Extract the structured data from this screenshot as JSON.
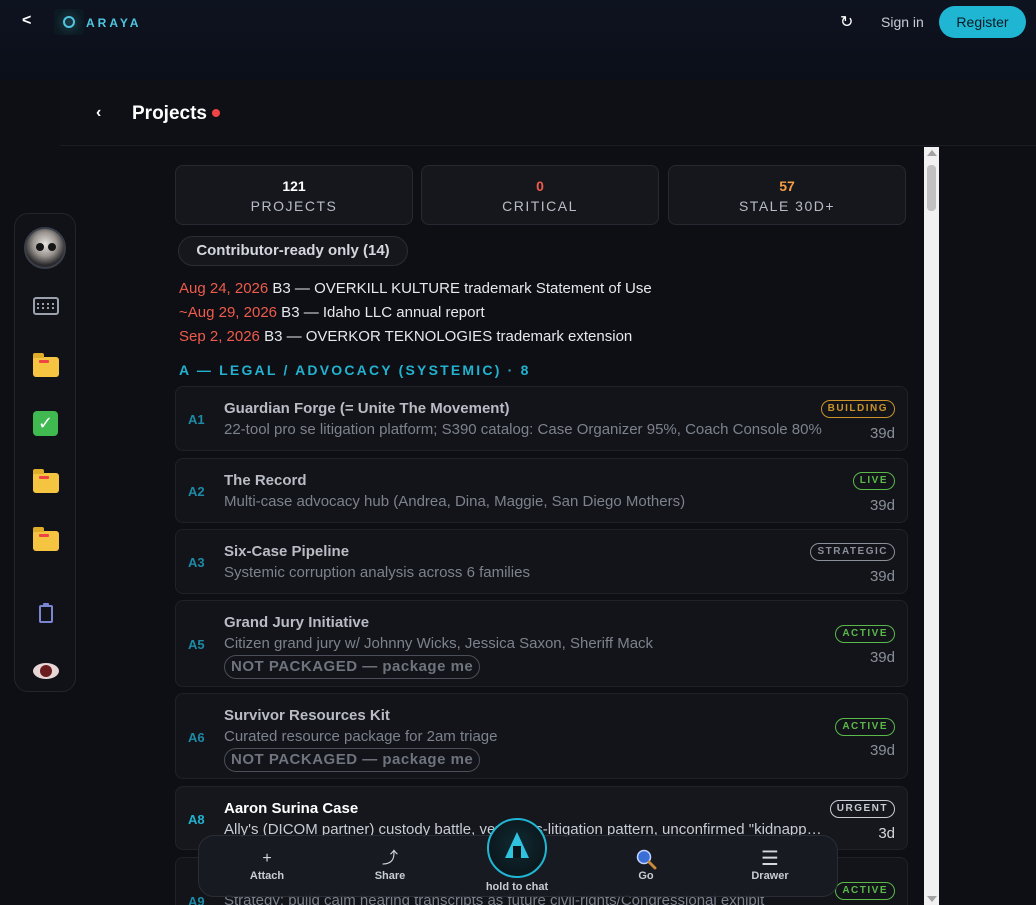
{
  "app": {
    "brand": "ARAYA",
    "back": "<"
  },
  "topbar": {
    "refresh": "↻",
    "signin": "Sign in",
    "register": "Register"
  },
  "page": {
    "back": "‹",
    "title": "Projects"
  },
  "stats": [
    {
      "value": "121",
      "label": "PROJECTS",
      "color": "#ffffff"
    },
    {
      "value": "0",
      "label": "CRITICAL",
      "color": "#ef5b4b"
    },
    {
      "value": "57",
      "label": "STALE 30D+",
      "color": "#f59e42"
    }
  ],
  "filter": {
    "label": "Contributor-ready only (14)"
  },
  "deadlines": [
    {
      "date": "Aug 24, 2026",
      "text": " B3 — OVERKILL KULTURE trademark Statement of Use"
    },
    {
      "date": "~Aug 29, 2026",
      "text": " B3 — Idaho LLC annual report"
    },
    {
      "date": "Sep 2, 2026",
      "text": " B3 — OVERKOR TEKNOLOGIES trademark extension"
    }
  ],
  "section": {
    "title": "A — LEGAL / ADVOCACY (SYSTEMIC) · 8"
  },
  "projects": [
    {
      "code": "A1",
      "title": "Guardian Forge (= Unite The Movement)",
      "desc": "22-tool pro se litigation platform; S390 catalog: Case Organizer 95%, Coach Console 80%",
      "badge": "BUILDING",
      "age": "39d",
      "pkg": ""
    },
    {
      "code": "A2",
      "title": "The Record",
      "desc": "Multi-case advocacy hub (Andrea, Dina, Maggie, San Diego Mothers)",
      "badge": "LIVE",
      "age": "39d",
      "pkg": ""
    },
    {
      "code": "A3",
      "title": "Six-Case Pipeline",
      "desc": "Systemic corruption analysis across 6 families",
      "badge": "STRATEGIC",
      "age": "39d",
      "pkg": ""
    },
    {
      "code": "A5",
      "title": "Grand Jury Initiative",
      "desc": "Citizen grand jury w/ Johnny Wicks, Jessica Saxon, Sheriff Mack",
      "badge": "ACTIVE",
      "age": "39d",
      "pkg": "NOT PACKAGED — package me"
    },
    {
      "code": "A6",
      "title": "Survivor Resources Kit",
      "desc": "Curated resource package for 2am triage",
      "badge": "ACTIVE",
      "age": "39d",
      "pkg": "NOT PACKAGED — package me"
    },
    {
      "code": "A8",
      "title": "Aaron Surina Case",
      "desc": "Ally's (DICOM partner) custody battle, vexatious-litigation pattern, unconfirmed \"kidnapping\" claims",
      "badge": "URGENT",
      "age": "3d",
      "pkg": ""
    },
    {
      "code": "A9",
      "title": "",
      "desc": "Strategy: build calm hearing transcripts as future civil-rights/Congressional exhibit",
      "badge": "ACTIVE",
      "age": "",
      "pkg": ""
    }
  ],
  "dock": {
    "attach": {
      "icon": "+",
      "label": "Attach"
    },
    "share": {
      "icon": "⤴",
      "label": "Share"
    },
    "chat": {
      "label": "hold to chat"
    },
    "go": {
      "label": "Go"
    },
    "drawer": {
      "icon": "☰",
      "label": "Drawer"
    }
  },
  "colors": {
    "accent": "#1fb6d3",
    "danger": "#ef5b4b",
    "warning": "#f59e42"
  }
}
